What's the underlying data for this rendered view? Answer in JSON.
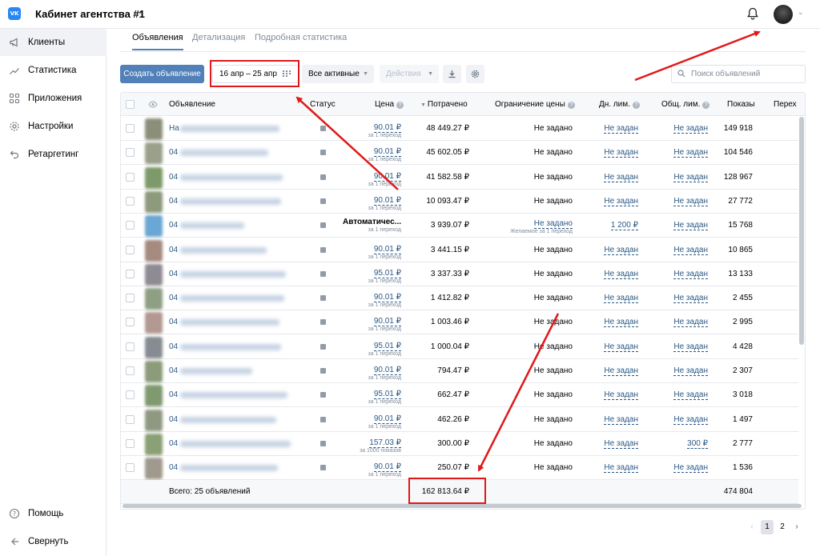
{
  "header": {
    "logo": "VK",
    "cabinet_title": "Кабинет агентства #1",
    "chevron": "⌄"
  },
  "sidebar": {
    "items": [
      {
        "label": "Клиенты",
        "icon": "megaphone-icon",
        "active": true
      },
      {
        "label": "Статистика",
        "icon": "chart-icon",
        "active": false
      },
      {
        "label": "Приложения",
        "icon": "apps-icon",
        "active": false
      },
      {
        "label": "Настройки",
        "icon": "gear-icon",
        "active": false
      },
      {
        "label": "Ретаргетинг",
        "icon": "retarget-icon",
        "active": false
      }
    ],
    "help": "Помощь",
    "collapse": "Свернуть"
  },
  "tabs": [
    {
      "label": "Объявления",
      "active": true
    },
    {
      "label": "Детализация",
      "active": false
    },
    {
      "label": "Подробная статистика",
      "active": false
    }
  ],
  "toolbar": {
    "create_label": "Создать объявление",
    "date_range": "16 апр – 25 апр",
    "filter_label": "Все активные",
    "actions_label": "Действия",
    "search_placeholder": "Поиск объявлений"
  },
  "table": {
    "headers": {
      "ad": "Объявление",
      "status": "Статус",
      "price": "Цена",
      "spent": "Потрачено",
      "price_limit": "Ограничение цены",
      "day_limit": "Дн. лим.",
      "total_limit": "Общ. лим.",
      "shows": "Показы",
      "clicks": "Перех"
    },
    "rows": [
      {
        "name": "На",
        "price": "90.01 ₽",
        "price_sub": "за 1 переход",
        "spent": "48 449.27 ₽",
        "price_limit": "Не задано",
        "day_limit": "Не задан",
        "total_limit": "Не задан",
        "shows": "149 918"
      },
      {
        "name": "04",
        "price": "90.01 ₽",
        "price_sub": "за 1 переход",
        "spent": "45 602.05 ₽",
        "price_limit": "Не задано",
        "day_limit": "Не задан",
        "total_limit": "Не задан",
        "shows": "104 546"
      },
      {
        "name": "04",
        "price": "90.01 ₽",
        "price_sub": "за 1 переход",
        "spent": "41 582.58 ₽",
        "price_limit": "Не задано",
        "day_limit": "Не задан",
        "total_limit": "Не задан",
        "shows": "128 967"
      },
      {
        "name": "04",
        "price": "90.01 ₽",
        "price_sub": "за 1 переход",
        "spent": "10 093.47 ₽",
        "price_limit": "Не задано",
        "day_limit": "Не задан",
        "total_limit": "Не задан",
        "shows": "27 772"
      },
      {
        "name": "04",
        "price": "Автоматичес...",
        "price_sub": "за 1 переход",
        "spent": "3 939.07 ₽",
        "price_limit": "Не задано",
        "price_limit_sub": "Желаемое за 1 переход",
        "day_limit": "1 200 ₽",
        "total_limit": "Не задан",
        "shows": "15 768"
      },
      {
        "name": "04",
        "price": "90.01 ₽",
        "price_sub": "за 1 переход",
        "spent": "3 441.15 ₽",
        "price_limit": "Не задано",
        "day_limit": "Не задан",
        "total_limit": "Не задан",
        "shows": "10 865"
      },
      {
        "name": "04",
        "price": "95.01 ₽",
        "price_sub": "за 1 переход",
        "spent": "3 337.33 ₽",
        "price_limit": "Не задано",
        "day_limit": "Не задан",
        "total_limit": "Не задан",
        "shows": "13 133"
      },
      {
        "name": "04",
        "price": "90.01 ₽",
        "price_sub": "за 1 переход",
        "spent": "1 412.82 ₽",
        "price_limit": "Не задано",
        "day_limit": "Не задан",
        "total_limit": "Не задан",
        "shows": "2 455"
      },
      {
        "name": "04",
        "price": "90.01 ₽",
        "price_sub": "за 1 переход",
        "spent": "1 003.46 ₽",
        "price_limit": "Не задано",
        "day_limit": "Не задан",
        "total_limit": "Не задан",
        "shows": "2 995"
      },
      {
        "name": "04",
        "price": "95.01 ₽",
        "price_sub": "за 1 переход",
        "spent": "1 000.04 ₽",
        "price_limit": "Не задано",
        "day_limit": "Не задан",
        "total_limit": "Не задан",
        "shows": "4 428"
      },
      {
        "name": "04",
        "price": "90.01 ₽",
        "price_sub": "за 1 переход",
        "spent": "794.47 ₽",
        "price_limit": "Не задано",
        "day_limit": "Не задан",
        "total_limit": "Не задан",
        "shows": "2 307"
      },
      {
        "name": "04",
        "price": "95.01 ₽",
        "price_sub": "за 1 переход",
        "spent": "662.47 ₽",
        "price_limit": "Не задано",
        "day_limit": "Не задан",
        "total_limit": "Не задан",
        "shows": "3 018"
      },
      {
        "name": "04",
        "price": "90.01 ₽",
        "price_sub": "за 1 переход",
        "spent": "462.26 ₽",
        "price_limit": "Не задано",
        "day_limit": "Не задан",
        "total_limit": "Не задан",
        "shows": "1 497"
      },
      {
        "name": "04",
        "price": "157.03 ₽",
        "price_sub": "за 1000 показов",
        "spent": "300.00 ₽",
        "price_limit": "Не задано",
        "day_limit": "Не задан",
        "total_limit": "300 ₽",
        "shows": "2 777"
      },
      {
        "name": "04",
        "price": "90.01 ₽",
        "price_sub": "за 1 переход",
        "spent": "250.07 ₽",
        "price_limit": "Не задано",
        "day_limit": "Не задан",
        "total_limit": "Не задан",
        "shows": "1 536"
      }
    ],
    "total": {
      "label": "Всего: 25 объявлений",
      "spent": "162 813.64 ₽",
      "shows": "474 804"
    }
  },
  "pagination": {
    "prev": "‹",
    "pages": [
      "1",
      "2"
    ],
    "next": "›",
    "current": "1"
  },
  "colors": {
    "accent": "#5181b8",
    "link": "#2a5885",
    "annotation": "#e11818"
  }
}
